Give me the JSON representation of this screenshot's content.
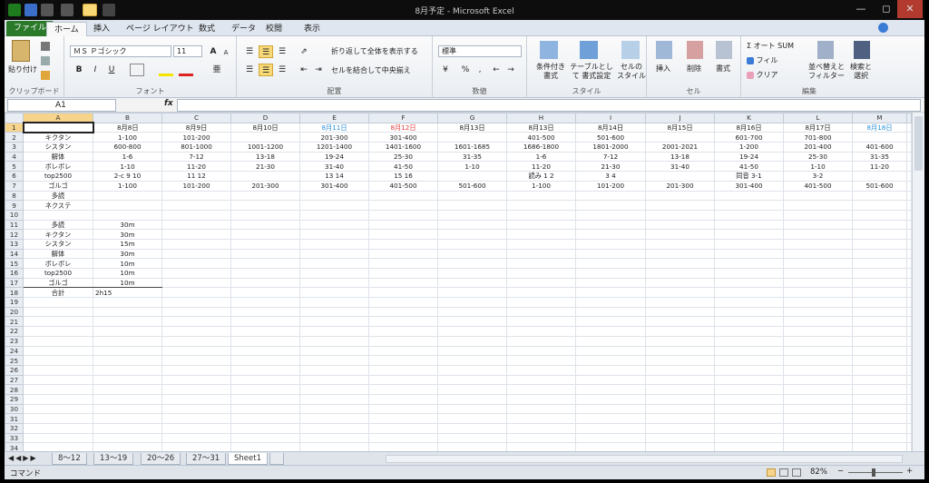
{
  "window": {
    "title": "8月予定 - Microsoft Excel"
  },
  "tabs": [
    "ファイル",
    "ホーム",
    "挿入",
    "ページ レイアウト",
    "数式",
    "データ",
    "校閲",
    "表示"
  ],
  "ribbon": {
    "clipboard": {
      "paste": "貼り付け",
      "label": "クリップボード"
    },
    "font": {
      "name": "ＭＳ Ｐゴシック",
      "size": "11",
      "grow": "A",
      "shrink": "A",
      "bold": "B",
      "italic": "I",
      "underline": "U",
      "label": "フォント"
    },
    "alignment": {
      "wrap": "折り返して全体を表示する",
      "merge": "セルを結合して中央揃え",
      "label": "配置"
    },
    "number": {
      "format": "標準",
      "percent": "%",
      "comma": ",",
      "label": "数値"
    },
    "styles": {
      "cond": "条件付き 書式",
      "table": "テーブルとして 書式設定",
      "cell": "セルの スタイル",
      "label": "スタイル"
    },
    "cells": {
      "insert": "挿入",
      "delete": "削除",
      "format": "書式",
      "label": "セル"
    },
    "editing": {
      "autosum": "オート SUM",
      "fill": "フィル",
      "clear": "クリア",
      "sort": "並べ替えと フィルター",
      "find": "検索と 選択",
      "label": "編集"
    }
  },
  "formula_bar": {
    "name_box": "A1",
    "fx": "fx",
    "value": ""
  },
  "columns": [
    "A",
    "B",
    "C",
    "D",
    "E",
    "F",
    "G",
    "H",
    "I",
    "J",
    "K",
    "L",
    "M"
  ],
  "rows": [
    {
      "n": "1",
      "c": [
        "",
        "8月8日",
        "8月9日",
        "8月10日",
        "8月11日",
        "8月12日",
        "8月13日",
        "8月13日",
        "8月14日",
        "8月15日",
        "8月16日",
        "8月17日",
        "8月18日"
      ]
    },
    {
      "n": "2",
      "c": [
        "キクタン",
        "1-100",
        "101-200",
        "",
        "201-300",
        "301-400",
        "",
        "401-500",
        "501-600",
        "",
        "601-700",
        "701-800",
        ""
      ]
    },
    {
      "n": "3",
      "c": [
        "シスタン",
        "600-800",
        "801-1000",
        "1001-1200",
        "1201-1400",
        "1401-1600",
        "1601-1685",
        "1686-1800",
        "1801-2000",
        "2001-2021",
        "1-200",
        "201-400",
        "401-600"
      ]
    },
    {
      "n": "4",
      "c": [
        "解体",
        "1-6",
        "7-12",
        "13-18",
        "19-24",
        "25-30",
        "31-35",
        "1-6",
        "7-12",
        "13-18",
        "19-24",
        "25-30",
        "31-35"
      ]
    },
    {
      "n": "5",
      "c": [
        "ボレボレ",
        "1-10",
        "11-20",
        "21-30",
        "31-40",
        "41-50",
        "1-10",
        "11-20",
        "21-30",
        "31-40",
        "41-50",
        "1-10",
        "11-20"
      ]
    },
    {
      "n": "6",
      "c": [
        "top2500",
        "2-c 9 10",
        "11 12",
        "",
        "13 14",
        "15 16",
        "",
        "読み 1 2",
        "3 4",
        "",
        "同音 3-1",
        "3-2",
        ""
      ]
    },
    {
      "n": "7",
      "c": [
        "ゴルゴ",
        "1-100",
        "101-200",
        "201-300",
        "301-400",
        "401-500",
        "501-600",
        "1-100",
        "101-200",
        "201-300",
        "301-400",
        "401-500",
        "501-600"
      ]
    },
    {
      "n": "8",
      "c": [
        "多読",
        "",
        "",
        "",
        "",
        "",
        "",
        "",
        "",
        "",
        "",
        "",
        ""
      ]
    },
    {
      "n": "9",
      "c": [
        "ネクステ",
        "",
        "",
        "",
        "",
        "",
        "",
        "",
        "",
        "",
        "",
        "",
        ""
      ]
    },
    {
      "n": "10",
      "c": [
        "",
        "",
        "",
        "",
        "",
        "",
        "",
        "",
        "",
        "",
        "",
        "",
        ""
      ]
    },
    {
      "n": "11",
      "c": [
        "多読",
        "30m",
        "",
        "",
        "",
        "",
        "",
        "",
        "",
        "",
        "",
        "",
        ""
      ]
    },
    {
      "n": "12",
      "c": [
        "キクタン",
        "30m",
        "",
        "",
        "",
        "",
        "",
        "",
        "",
        "",
        "",
        "",
        ""
      ]
    },
    {
      "n": "13",
      "c": [
        "シスタン",
        "15m",
        "",
        "",
        "",
        "",
        "",
        "",
        "",
        "",
        "",
        "",
        ""
      ]
    },
    {
      "n": "14",
      "c": [
        "解体",
        "30m",
        "",
        "",
        "",
        "",
        "",
        "",
        "",
        "",
        "",
        "",
        ""
      ]
    },
    {
      "n": "15",
      "c": [
        "ボレボレ",
        "10m",
        "",
        "",
        "",
        "",
        "",
        "",
        "",
        "",
        "",
        "",
        ""
      ]
    },
    {
      "n": "16",
      "c": [
        "top2500",
        "10m",
        "",
        "",
        "",
        "",
        "",
        "",
        "",
        "",
        "",
        "",
        ""
      ]
    },
    {
      "n": "17",
      "c": [
        "ゴルゴ",
        "10m",
        "",
        "",
        "",
        "",
        "",
        "",
        "",
        "",
        "",
        "",
        ""
      ]
    },
    {
      "n": "18",
      "c": [
        "合計",
        "2h15",
        "",
        "",
        "",
        "",
        "",
        "",
        "",
        "",
        "",
        "",
        ""
      ]
    }
  ],
  "empty_rows": [
    "19",
    "20",
    "21",
    "22",
    "23",
    "24",
    "25",
    "26",
    "27",
    "28",
    "29",
    "30",
    "31",
    "32",
    "33",
    "34",
    "35",
    "36",
    "37",
    "38"
  ],
  "colors": {
    "sat": "#2a8fd6",
    "sun": "#e03a3a",
    "file_tab": "#2a7a2a"
  },
  "sheet_tabs": [
    "8～12",
    "13～19",
    "20～26",
    "27～31",
    "Sheet1"
  ],
  "status": {
    "mode": "コマンド",
    "zoom": "82%"
  }
}
